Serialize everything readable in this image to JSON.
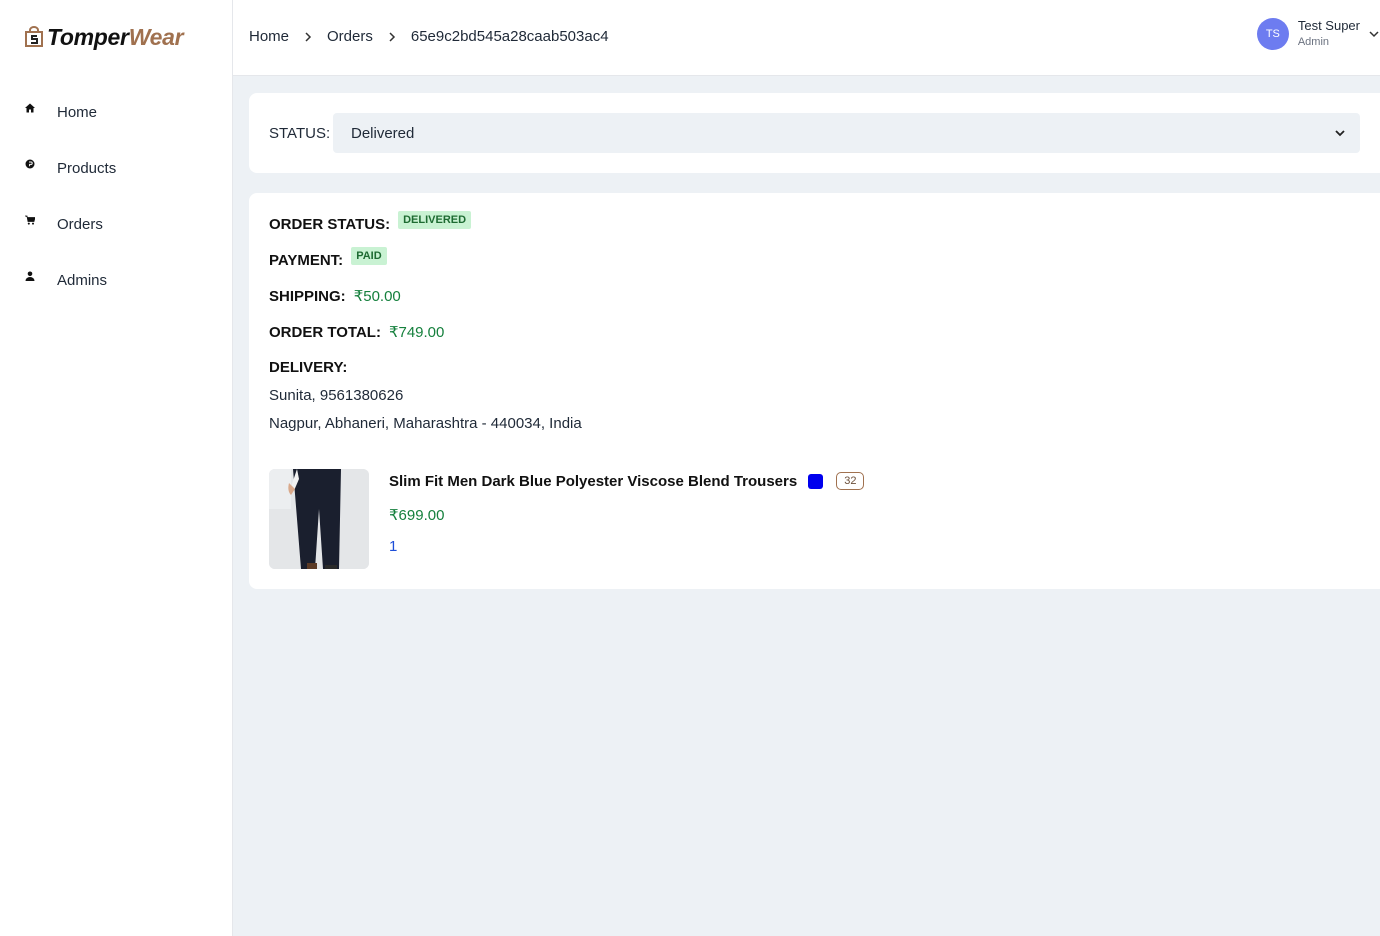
{
  "brand": {
    "name_part1": "Tomper",
    "name_part2": "Wear",
    "accent_color": "#a0714f"
  },
  "sidebar": {
    "items": [
      {
        "label": "Home",
        "icon": "home-icon"
      },
      {
        "label": "Products",
        "icon": "product-icon"
      },
      {
        "label": "Orders",
        "icon": "cart-icon"
      },
      {
        "label": "Admins",
        "icon": "user-icon"
      }
    ]
  },
  "header": {
    "breadcrumb": [
      "Home",
      "Orders",
      "65e9c2bd545a28caab503ac4"
    ],
    "user": {
      "initials": "TS",
      "name": "Test Super",
      "role": "Admin"
    }
  },
  "status_form": {
    "label": "STATUS:",
    "selected": "Delivered"
  },
  "order": {
    "status_label": "ORDER STATUS:",
    "status_badge": "DELIVERED",
    "payment_label": "PAYMENT:",
    "payment_badge": "PAID",
    "shipping_label": "SHIPPING:",
    "shipping_value": "₹50.00",
    "total_label": "ORDER TOTAL:",
    "total_value": "₹749.00",
    "delivery_label": "DELIVERY:",
    "delivery_contact": "Sunita, 9561380626",
    "delivery_address": "Nagpur, Abhaneri, Maharashtra - 440034, India"
  },
  "product": {
    "name": "Slim Fit Men Dark Blue Polyester Viscose Blend Trousers",
    "color": "#0000ee",
    "size": "32",
    "price": "₹699.00",
    "quantity": "1"
  }
}
